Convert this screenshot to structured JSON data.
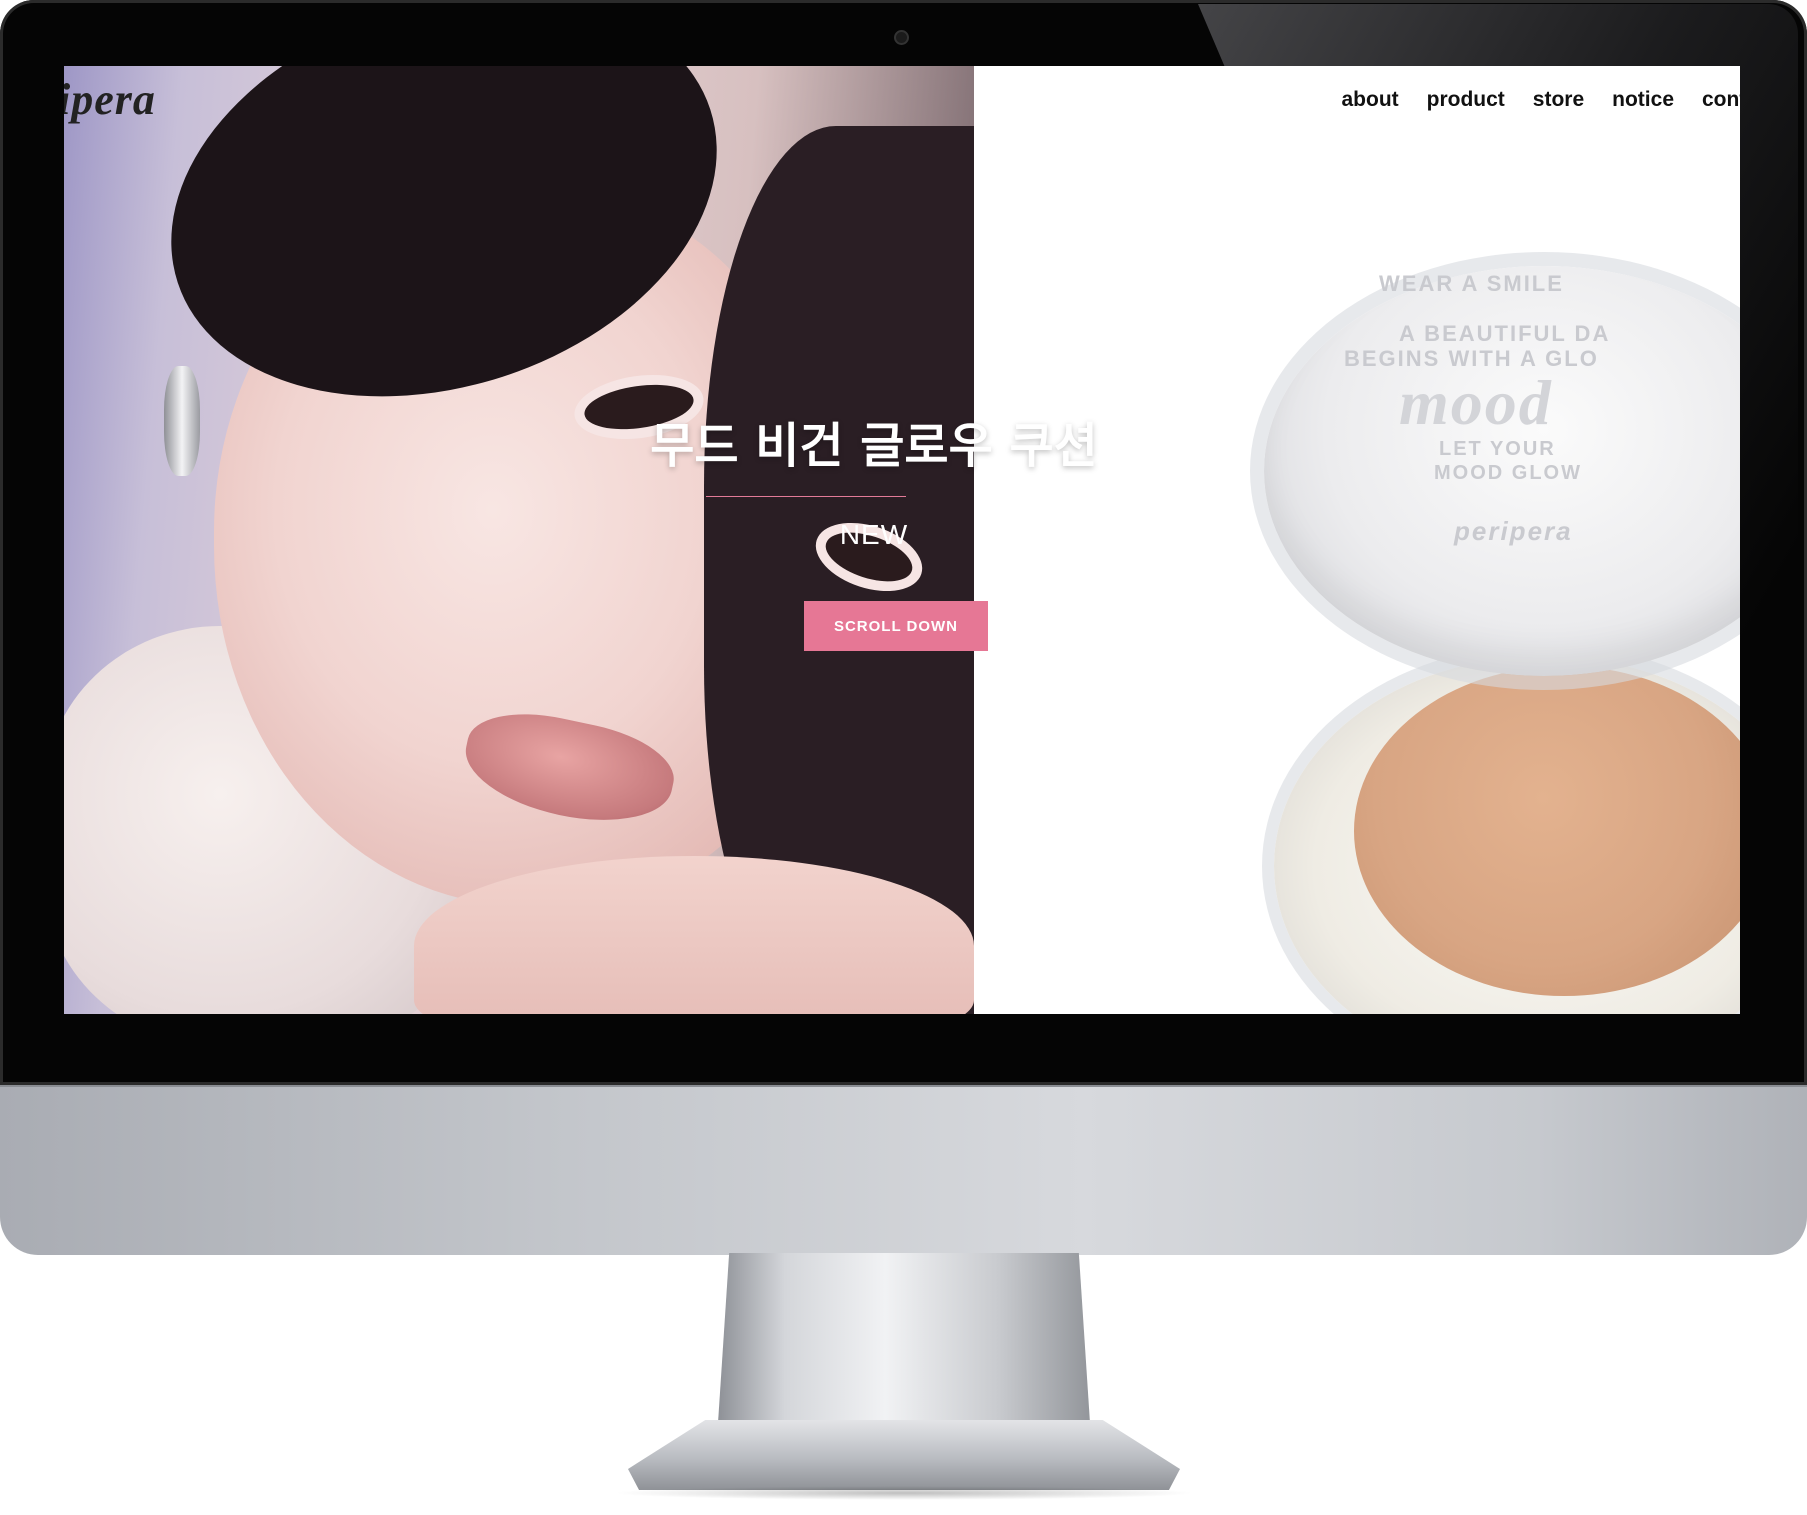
{
  "site": {
    "logo_text": "ipera"
  },
  "nav": {
    "items": [
      "about",
      "product",
      "store",
      "notice",
      "cont"
    ]
  },
  "hero": {
    "title": "무드 비건 글로우 쿠션",
    "subtitle": "NEW",
    "cta_label": "SCROLL DOWN",
    "accent_color": "#e67795"
  },
  "product": {
    "lid_lines": [
      "WEAR A SMILE",
      "A BEAUTIFUL DA",
      "BEGINS WITH A GLO",
      "mood",
      "LET YOUR",
      "MOOD GLOW",
      "peripera"
    ]
  }
}
